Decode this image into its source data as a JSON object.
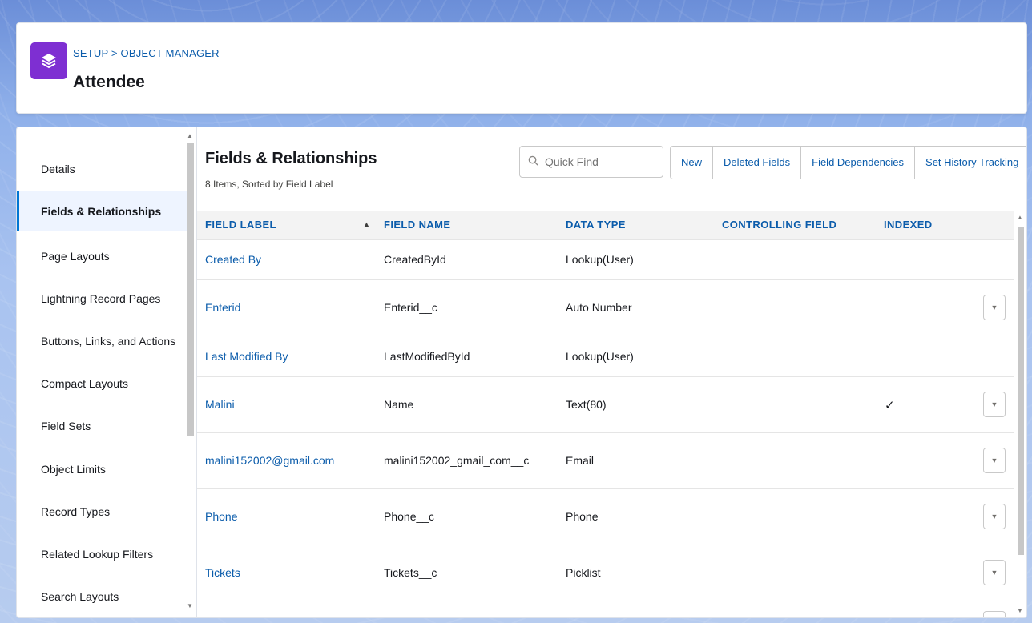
{
  "header": {
    "breadcrumb": "SETUP > OBJECT MANAGER",
    "title": "Attendee",
    "icon": "layers-icon",
    "icon_color": "#7e2fd2"
  },
  "nav": {
    "items": [
      {
        "label": "Details"
      },
      {
        "label": "Fields & Relationships",
        "active": true
      },
      {
        "label": "Page Layouts"
      },
      {
        "label": "Lightning Record Pages"
      },
      {
        "label": "Buttons, Links, and Actions"
      },
      {
        "label": "Compact Layouts"
      },
      {
        "label": "Field Sets"
      },
      {
        "label": "Object Limits"
      },
      {
        "label": "Record Types"
      },
      {
        "label": "Related Lookup Filters"
      },
      {
        "label": "Search Layouts"
      }
    ]
  },
  "section": {
    "title": "Fields & Relationships",
    "subtitle": "8 Items, Sorted by Field Label"
  },
  "search": {
    "placeholder": "Quick Find",
    "value": ""
  },
  "buttons": {
    "new": "New",
    "deleted_fields": "Deleted Fields",
    "field_dependencies": "Field Dependencies",
    "set_history_tracking": "Set History Tracking"
  },
  "table": {
    "columns": [
      "FIELD LABEL",
      "FIELD NAME",
      "DATA TYPE",
      "CONTROLLING FIELD",
      "INDEXED"
    ],
    "sort": {
      "column": "FIELD LABEL",
      "direction": "ascending"
    },
    "rows": [
      {
        "label": "Created By",
        "name": "CreatedById",
        "type": "Lookup(User)",
        "controlling": "",
        "indexed": false,
        "menu": false
      },
      {
        "label": "Enterid",
        "name": "Enterid__c",
        "type": "Auto Number",
        "controlling": "",
        "indexed": false,
        "menu": true
      },
      {
        "label": "Last Modified By",
        "name": "LastModifiedById",
        "type": "Lookup(User)",
        "controlling": "",
        "indexed": false,
        "menu": false
      },
      {
        "label": "Malini",
        "name": "Name",
        "type": "Text(80)",
        "controlling": "",
        "indexed": true,
        "menu": true
      },
      {
        "label": "malini152002@gmail.com",
        "name": "malini152002_gmail_com__c",
        "type": "Email",
        "controlling": "",
        "indexed": false,
        "menu": true
      },
      {
        "label": "Phone",
        "name": "Phone__c",
        "type": "Phone",
        "controlling": "",
        "indexed": false,
        "menu": true
      },
      {
        "label": "Tickets",
        "name": "Tickets__c",
        "type": "Picklist",
        "controlling": "",
        "indexed": false,
        "menu": true
      }
    ]
  },
  "colors": {
    "link": "#0b5cab",
    "accent": "#0176d3",
    "header_bg": "#f3f3f3"
  }
}
